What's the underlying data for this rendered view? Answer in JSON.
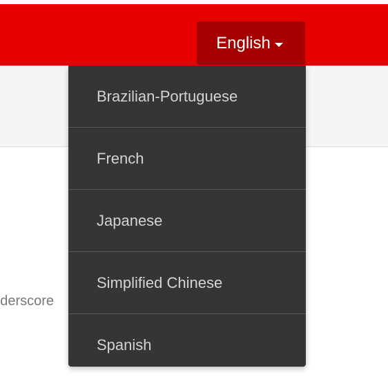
{
  "header": {
    "language_button_label": "English"
  },
  "background": {
    "partial_text": "underscore"
  },
  "dropdown": {
    "items": [
      {
        "label": "Brazilian-Portuguese"
      },
      {
        "label": "French"
      },
      {
        "label": "Japanese"
      },
      {
        "label": "Simplified Chinese"
      },
      {
        "label": "Spanish"
      }
    ]
  },
  "colors": {
    "header": "#e60000",
    "button": "#a70000",
    "dropdown": "#353535",
    "dropdown_text": "#d3d3d3"
  }
}
